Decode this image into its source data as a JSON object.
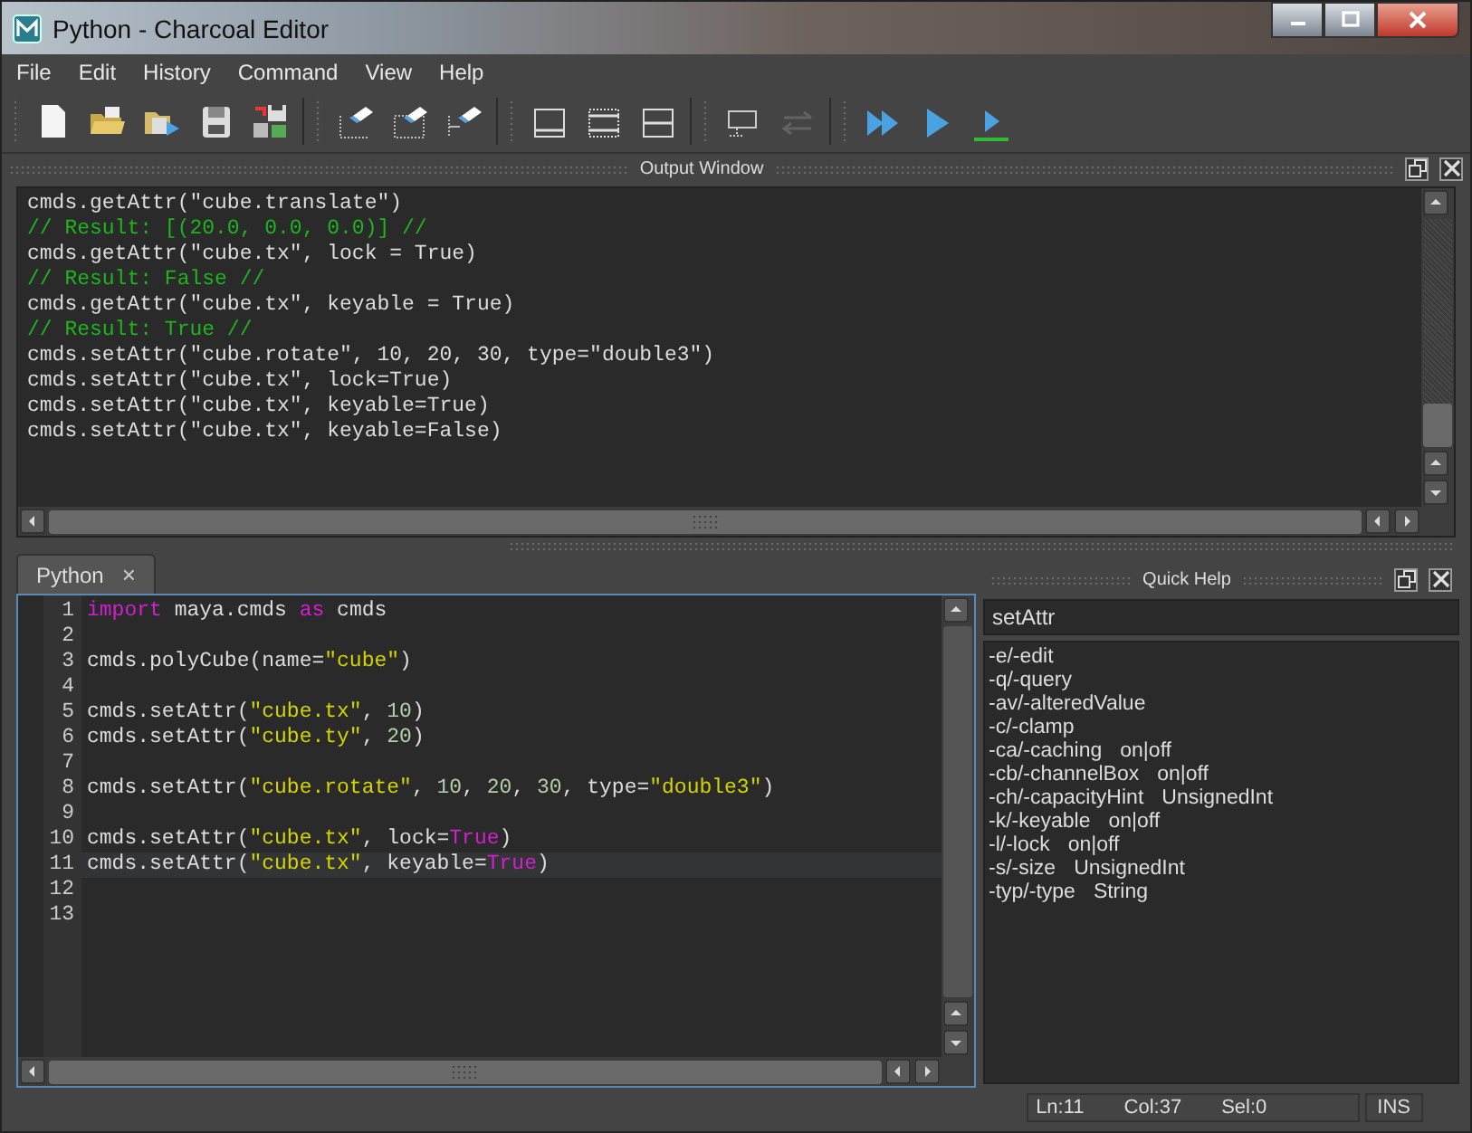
{
  "window": {
    "title": "Python - Charcoal Editor"
  },
  "menu": [
    "File",
    "Edit",
    "History",
    "Command",
    "View",
    "Help"
  ],
  "toolbar": [
    [
      {
        "kind": "new",
        "disabled": false
      },
      {
        "kind": "open",
        "disabled": false
      },
      {
        "kind": "source",
        "disabled": false
      },
      {
        "kind": "save",
        "disabled": false
      },
      {
        "kind": "save-shelf",
        "disabled": false
      }
    ],
    [
      {
        "kind": "clear-history",
        "disabled": false
      },
      {
        "kind": "clear-input",
        "disabled": false
      },
      {
        "kind": "clear-all",
        "disabled": false
      }
    ],
    [
      {
        "kind": "show-history",
        "disabled": false
      },
      {
        "kind": "show-both",
        "disabled": false
      },
      {
        "kind": "show-input",
        "disabled": false
      }
    ],
    [
      {
        "kind": "echo",
        "disabled": false
      },
      {
        "kind": "swap",
        "disabled": true
      }
    ],
    [
      {
        "kind": "run-all",
        "disabled": false
      },
      {
        "kind": "run",
        "disabled": false
      },
      {
        "kind": "run-selected",
        "disabled": false
      }
    ]
  ],
  "output_window": {
    "title": "Output Window",
    "lines": [
      {
        "kind": "command",
        "text": "cmds.getAttr(\"cube.translate\")"
      },
      {
        "kind": "result",
        "text": "// Result: [(20.0, 0.0, 0.0)] //"
      },
      {
        "kind": "command",
        "text": "cmds.getAttr(\"cube.tx\", lock = True)"
      },
      {
        "kind": "result",
        "text": "// Result: False //"
      },
      {
        "kind": "command",
        "text": "cmds.getAttr(\"cube.tx\", keyable = True)"
      },
      {
        "kind": "result",
        "text": "// Result: True //"
      },
      {
        "kind": "command",
        "text": "cmds.setAttr(\"cube.rotate\", 10, 20, 30, type=\"double3\")"
      },
      {
        "kind": "command",
        "text": "cmds.setAttr(\"cube.tx\", lock=True)"
      },
      {
        "kind": "command",
        "text": "cmds.setAttr(\"cube.tx\", keyable=True)"
      },
      {
        "kind": "command",
        "text": "cmds.setAttr(\"cube.tx\", keyable=False)"
      }
    ]
  },
  "tabs": [
    {
      "label": "Python",
      "close": "×",
      "selected": true
    }
  ],
  "editor": {
    "lines": [
      {
        "number": "1",
        "current": false,
        "segments": [
          {
            "text": "import",
            "kind": "keyword"
          },
          {
            "text": " maya.cmds ",
            "kind": "plain"
          },
          {
            "text": "as",
            "kind": "keyword"
          },
          {
            "text": " cmds",
            "kind": "plain"
          }
        ]
      },
      {
        "number": "2",
        "current": false
      },
      {
        "number": "3",
        "current": false,
        "segments": [
          {
            "text": "cmds.polyCube(name=",
            "kind": "plain"
          },
          {
            "text": "\"cube\"",
            "kind": "string"
          },
          {
            "text": ")",
            "kind": "plain"
          }
        ]
      },
      {
        "number": "4",
        "current": false
      },
      {
        "number": "5",
        "current": false,
        "segments": [
          {
            "text": "cmds.setAttr(",
            "kind": "plain"
          },
          {
            "text": "\"cube.tx\"",
            "kind": "string"
          },
          {
            "text": ", ",
            "kind": "plain"
          },
          {
            "text": "10",
            "kind": "number"
          },
          {
            "text": ")",
            "kind": "plain"
          }
        ]
      },
      {
        "number": "6",
        "current": false,
        "segments": [
          {
            "text": "cmds.setAttr(",
            "kind": "plain"
          },
          {
            "text": "\"cube.ty\"",
            "kind": "string"
          },
          {
            "text": ", ",
            "kind": "plain"
          },
          {
            "text": "20",
            "kind": "number"
          },
          {
            "text": ")",
            "kind": "plain"
          }
        ]
      },
      {
        "number": "7",
        "current": false
      },
      {
        "number": "8",
        "current": false,
        "segments": [
          {
            "text": "cmds.setAttr(",
            "kind": "plain"
          },
          {
            "text": "\"cube.rotate\"",
            "kind": "string"
          },
          {
            "text": ", ",
            "kind": "plain"
          },
          {
            "text": "10",
            "kind": "number"
          },
          {
            "text": ", ",
            "kind": "plain"
          },
          {
            "text": "20",
            "kind": "number"
          },
          {
            "text": ", ",
            "kind": "plain"
          },
          {
            "text": "30",
            "kind": "number"
          },
          {
            "text": ", type=",
            "kind": "plain"
          },
          {
            "text": "\"double3\"",
            "kind": "string"
          },
          {
            "text": ")",
            "kind": "plain"
          }
        ]
      },
      {
        "number": "9",
        "current": false
      },
      {
        "number": "10",
        "current": false,
        "segments": [
          {
            "text": "cmds.setAttr(",
            "kind": "plain"
          },
          {
            "text": "\"cube.tx\"",
            "kind": "string"
          },
          {
            "text": ", lock=",
            "kind": "plain"
          },
          {
            "text": "True",
            "kind": "keyword"
          },
          {
            "text": ")",
            "kind": "plain"
          }
        ]
      },
      {
        "number": "11",
        "current": true,
        "segments": [
          {
            "text": "cmds.setAttr(",
            "kind": "plain"
          },
          {
            "text": "\"cube.tx\"",
            "kind": "string"
          },
          {
            "text": ", keyable=",
            "kind": "plain"
          },
          {
            "text": "True",
            "kind": "keyword"
          },
          {
            "text": ")",
            "kind": "plain"
          }
        ]
      },
      {
        "number": "12",
        "current": false
      },
      {
        "number": "13",
        "current": false
      }
    ]
  },
  "quick_help": {
    "title": "Quick Help",
    "search": "setAttr",
    "items": [
      {
        "flag": "-e/-edit"
      },
      {
        "flag": "-q/-query"
      },
      {
        "flag": "-av/-alteredValue"
      },
      {
        "flag": "-c/-clamp"
      },
      {
        "flag": "-ca/-caching",
        "arg": "on|off"
      },
      {
        "flag": "-cb/-channelBox",
        "arg": "on|off"
      },
      {
        "flag": "-ch/-capacityHint",
        "arg": "UnsignedInt"
      },
      {
        "flag": "-k/-keyable",
        "arg": "on|off"
      },
      {
        "flag": "-l/-lock",
        "arg": "on|off"
      },
      {
        "flag": "-s/-size",
        "arg": "UnsignedInt"
      },
      {
        "flag": "-typ/-type",
        "arg": "String"
      }
    ]
  },
  "status_bar": {
    "line": "Ln:11",
    "column": "Col:37",
    "selection": "Sel:0",
    "mode": "INS"
  }
}
